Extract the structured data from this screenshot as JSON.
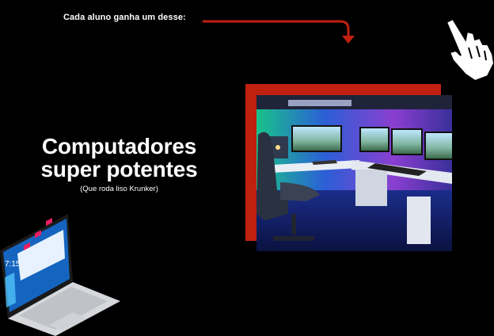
{
  "caption": "Cada aluno ganha um desse:",
  "headline": {
    "line1": "Computadores",
    "line2": "super potentes",
    "subtitle": "(Que roda liso Krunker)"
  },
  "laptop": {
    "clock": "7:15"
  },
  "colors": {
    "background": "#000000",
    "accent_red": "#c0200f",
    "text": "#ffffff"
  },
  "icons": [
    "arrow-down-icon",
    "hand-cursor-icon",
    "laptop-illustration"
  ]
}
